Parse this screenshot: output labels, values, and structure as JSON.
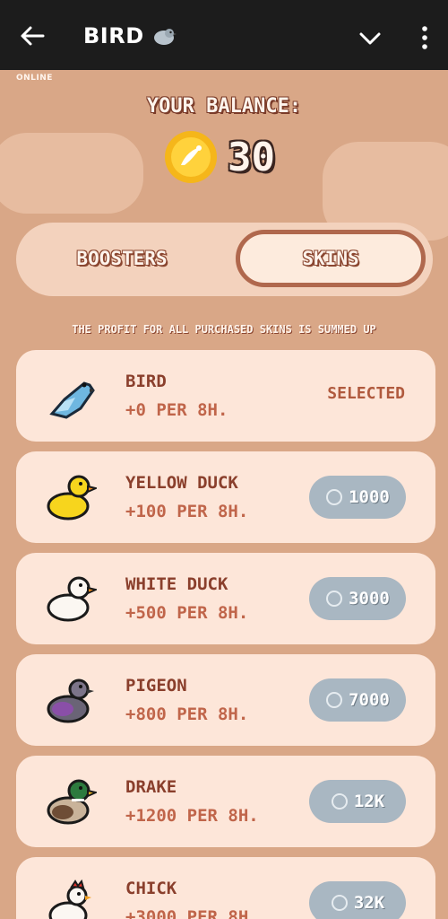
{
  "header": {
    "title": "BIRD",
    "title_icon": "bird-emoji-icon"
  },
  "status": {
    "online": "ONLINE"
  },
  "balance": {
    "label": "YOUR BALANCE:",
    "value": "30",
    "icon": "coin-icon"
  },
  "tabs": [
    {
      "label": "BOOSTERS",
      "active": false
    },
    {
      "label": "SKINS",
      "active": true
    }
  ],
  "note": "THE PROFIT FOR ALL PURCHASED SKINS IS SUMMED UP",
  "skins": [
    {
      "name": "BIRD",
      "profit": "+0 PER 8H.",
      "status": "SELECTED",
      "icon": "blue-bird-icon"
    },
    {
      "name": "YELLOW DUCK",
      "profit": "+100 PER 8H.",
      "price": "1000",
      "icon": "yellow-duck-icon"
    },
    {
      "name": "WHITE DUCK",
      "profit": "+500 PER 8H.",
      "price": "3000",
      "icon": "white-duck-icon"
    },
    {
      "name": "PIGEON",
      "profit": "+800 PER 8H.",
      "price": "7000",
      "icon": "pigeon-icon"
    },
    {
      "name": "DRAKE",
      "profit": "+1200 PER 8H.",
      "price": "12K",
      "icon": "drake-icon"
    },
    {
      "name": "CHICK",
      "profit": "+3000 PER 8H.",
      "price": "32K",
      "icon": "chick-icon"
    }
  ],
  "colors": {
    "background": "#d9a787",
    "card": "#fde6d9",
    "price_button": "#a9b7c2",
    "accent": "#8a3f2c"
  }
}
